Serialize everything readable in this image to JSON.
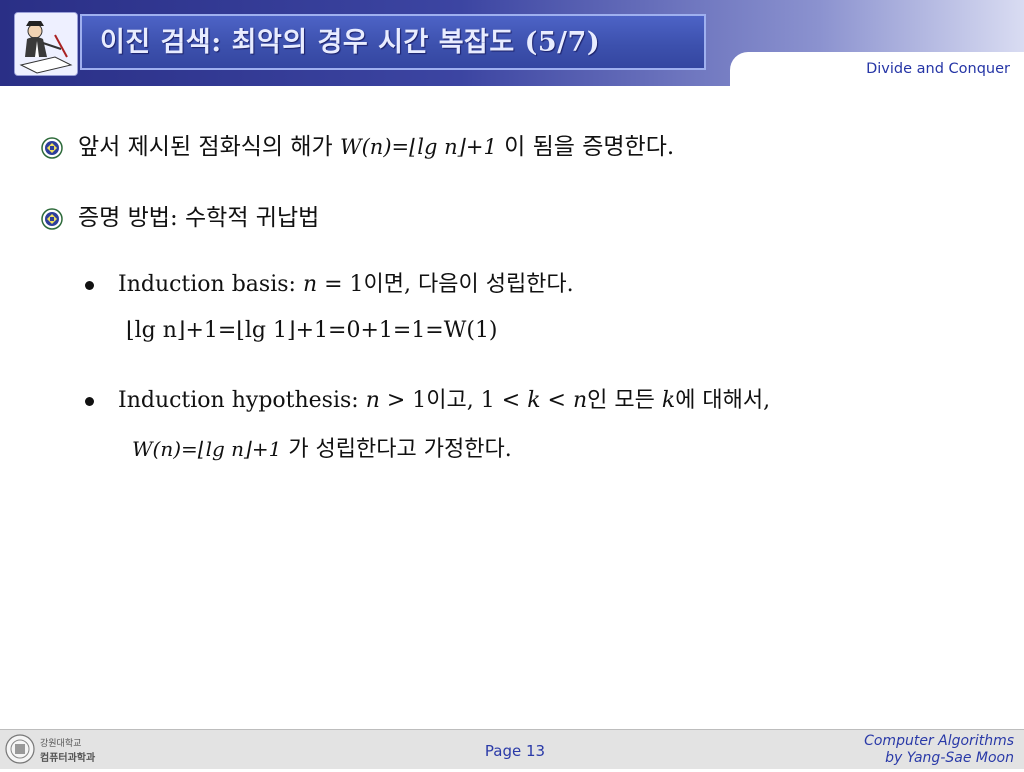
{
  "header": {
    "title": "이진 검색: 최악의 경우 시간 복잡도 (5/7)",
    "subtitle": "Divide and Conquer"
  },
  "bullets": [
    {
      "text_before": "앞서 제시된 점화식의 해가 ",
      "formula": "W(n)=⌊lg n⌋+1",
      "text_after": "이 됨을 증명한다."
    },
    {
      "text": "증명 방법: 수학적 귀납법"
    }
  ],
  "sub_bullets": [
    {
      "lead": "Induction basis: ",
      "var": "n",
      "rest": " = 1이면, 다음이 성립한다.",
      "formula": "⌊lg n⌋+1=⌊lg 1⌋+1=0+1=1=W(1)"
    },
    {
      "lead": "Induction hypothesis: ",
      "var": "n",
      "mid1": " > 1이고, 1 < ",
      "var2": "k",
      "mid2": " < ",
      "var3": "n",
      "mid3": "인 모든 ",
      "var4": "k",
      "rest": "에 대해서,",
      "formula": "W(n)=⌊lg n⌋+1",
      "formula_after": " 가 성립한다고 가정한다."
    }
  ],
  "footer": {
    "page": "Page 13",
    "credit_line1": "Computer Algorithms",
    "credit_line2": "by Yang-Sae Moon",
    "logo_text_top": "강원대학교",
    "logo_text_bottom": "컴퓨터과학과"
  },
  "colors": {
    "header_dark": "#2a2f86",
    "title_text": "#e8ecff",
    "accent_blue": "#2a3aa8"
  }
}
